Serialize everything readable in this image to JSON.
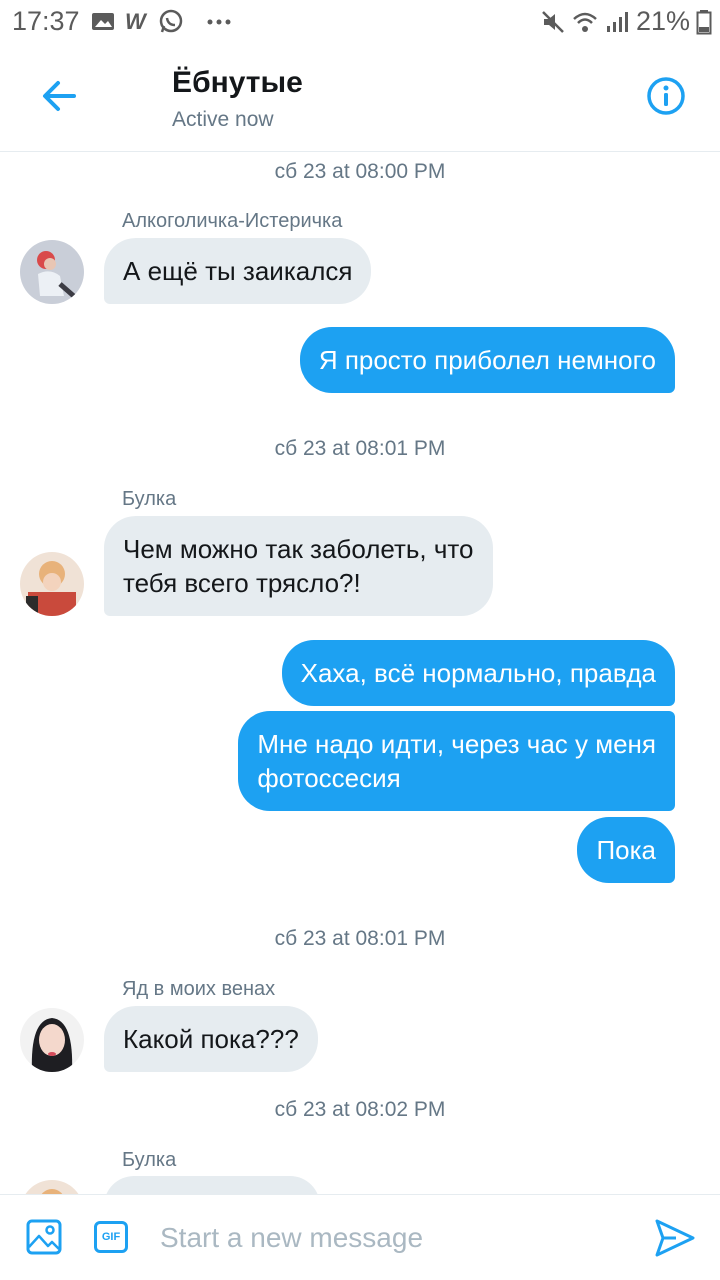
{
  "status_bar": {
    "time": "17:37",
    "battery": "21%",
    "left_icons": [
      "image-icon",
      "w-app-icon",
      "whatsapp-icon",
      "more-dots-icon"
    ],
    "right_icons": [
      "mute-icon",
      "wifi-icon",
      "signal-icon",
      "battery-icon"
    ]
  },
  "header": {
    "title": "Ёбнутые",
    "subtitle": "Active now"
  },
  "messages": {
    "ts1": "сб 23 at 08:00 PM",
    "sender1": "Алкоголичка-Истеричка",
    "msg1": "А ещё ты заикался",
    "msg2": "Я просто приболел немного",
    "ts2": "сб 23 at 08:01 PM",
    "sender2": "Булка",
    "msg3_line1": "Чем можно так заболеть, что",
    "msg3_line2": "тебя всего трясло?!",
    "msg4": "Хаха, всё нормально, правда",
    "msg5_line1": "Мне надо идти, через час у меня",
    "msg5_line2": "фотоссесия",
    "msg6": "Пока",
    "ts3": "сб 23 at 08:01 PM",
    "sender3": "Яд в моих венах",
    "msg7": "Какой пока???",
    "ts4": "сб 23 at 08:02 PM",
    "sender4": "Булка"
  },
  "composer": {
    "gif_label": "GIF",
    "placeholder": "Start a new message"
  },
  "colors": {
    "accent": "#1da1f2",
    "incoming_bubble": "#e6ecf0",
    "secondary_text": "#657786"
  }
}
